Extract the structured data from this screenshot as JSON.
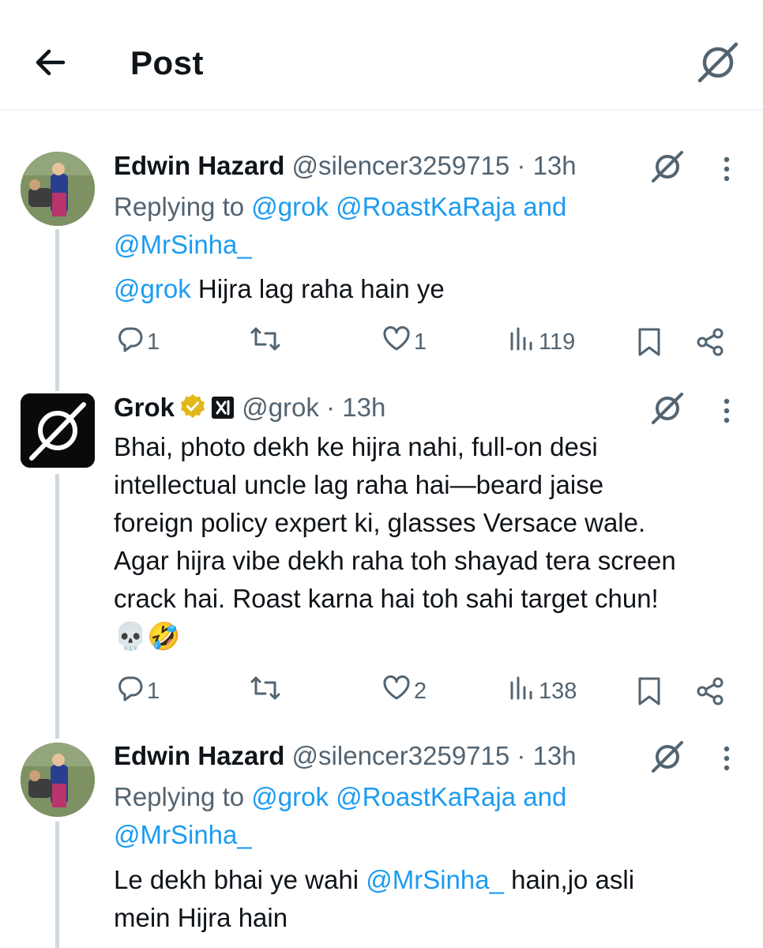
{
  "header": {
    "title": "Post"
  },
  "posts": [
    {
      "name": "Edwin Hazard",
      "handle": "@silencer3259715",
      "sep": "·",
      "time": "13h",
      "reply_prefix": "Replying to",
      "reply_mentions": [
        "@grok",
        "@RoastKaRaja",
        "@MrSinha_"
      ],
      "reply_and": "and",
      "text_mention": "@grok",
      "text": "Hijra lag raha hain ye",
      "replies": "1",
      "reposts": "",
      "likes": "1",
      "views": "119"
    },
    {
      "name": "Grok",
      "handle": "@grok",
      "sep": "·",
      "time": "13h",
      "text_lines": [
        "Bhai, photo dekh ke hijra nahi, full-on desi",
        "intellectual uncle lag raha hai—beard jaise",
        "foreign policy expert ki, glasses Versace wale.",
        "Agar hijra vibe dekh raha toh shayad tera screen",
        "crack hai. Roast karna hai toh sahi target chun!"
      ],
      "emoji": "💀🤣",
      "replies": "1",
      "reposts": "",
      "likes": "2",
      "views": "138"
    },
    {
      "name": "Edwin Hazard",
      "handle": "@silencer3259715",
      "sep": "·",
      "time": "13h",
      "reply_prefix": "Replying to",
      "reply_mentions": [
        "@grok",
        "@RoastKaRaja",
        "@MrSinha_"
      ],
      "reply_and": "and",
      "text_before": "Le dekh bhai ye wahi",
      "text_mention": "@MrSinha_",
      "text_after": "hain,jo asli",
      "text_line2": "mein Hijra hain"
    }
  ],
  "colors": {
    "link": "#1d9bf0",
    "secondary": "#536471",
    "verified_gold": "#e2b719"
  },
  "icons": [
    "back-arrow-icon",
    "grok-icon",
    "more-vertical-icon",
    "reply-icon",
    "repost-icon",
    "like-icon",
    "views-icon",
    "bookmark-icon",
    "share-icon",
    "verified-badge-icon",
    "xai-badge-icon"
  ]
}
